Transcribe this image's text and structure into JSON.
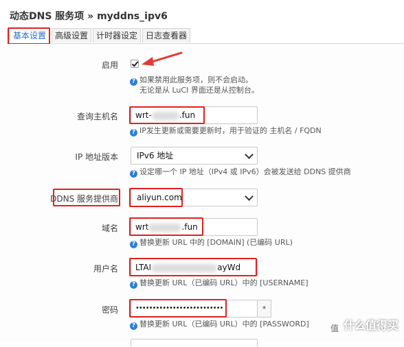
{
  "header": {
    "title": "动态DNS 服务项 » myddns_ipv6"
  },
  "tabs": [
    {
      "label": "基本设置"
    },
    {
      "label": "高级设置"
    },
    {
      "label": "计时器设定"
    },
    {
      "label": "日志查看器"
    }
  ],
  "form": {
    "enable": {
      "label": "启用",
      "checked": true,
      "help_line1": "如果禁用此服务项，则不会启动。",
      "help_line2": "无论是从 LuCI 界面还是从控制台。"
    },
    "lookup_host": {
      "label": "查询主机名",
      "value_prefix": "wrt-",
      "value_suffix": ".fun",
      "help": "IP发生更新或需要更新时，用于验证的 主机名 / FQDN"
    },
    "ip_version": {
      "label": "IP 地址版本",
      "value": "IPv6 地址",
      "help": "设定哪一个 IP 地址（IPv4 或 IPv6）会被发送给 DDNS 提供商"
    },
    "provider": {
      "label": "DDNS 服务提供商",
      "value": "aliyun.com"
    },
    "domain": {
      "label": "域名",
      "value_prefix": "wrt",
      "value_suffix": ".fun",
      "help": "替换更新 URL 中的 [DOMAIN] (已编码 URL)"
    },
    "username": {
      "label": "用户名",
      "value_prefix": "LTAI",
      "value_suffix": "ayWd",
      "help": "替换更新 URL（已编码 URL）中的 [USERNAME]"
    },
    "password": {
      "label": "密码",
      "value": "••••••••••••••••••••••••••",
      "addon": "*",
      "help": "替换更新 URL（已编码 URL）中的 [PASSWORD]"
    }
  },
  "watermark": {
    "text": "什么值得买",
    "logo": "值"
  }
}
